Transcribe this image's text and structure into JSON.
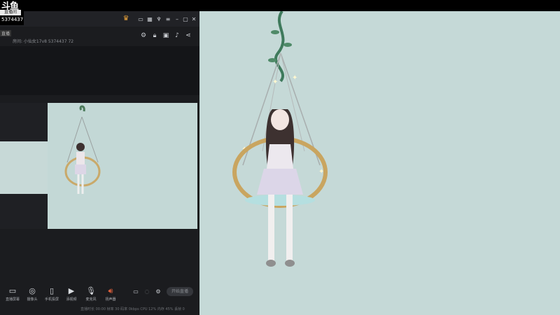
{
  "overlay": {
    "brand": "斗鱼",
    "tag": "直播间",
    "room_id": "5374437"
  },
  "app": {
    "live_tag": "直播",
    "room_meta": "房间: 小仙女17v8   5374437   72",
    "header_icons": [
      "settings-icon",
      "lock-icon",
      "gallery-icon",
      "bell-icon",
      "share-icon"
    ],
    "window_icons": [
      "skin-icon",
      "chat-icon",
      "grid-icon",
      "shirt-icon",
      "menu-icon",
      "minimize-icon",
      "maximize-icon",
      "close-icon"
    ]
  },
  "toolbar": {
    "items": [
      {
        "icon": "screen-capture-icon",
        "label": "直播屏幕"
      },
      {
        "icon": "camera-icon",
        "label": "摄像头"
      },
      {
        "icon": "phone-cast-icon",
        "label": "手机投屏"
      },
      {
        "icon": "media-icon",
        "label": "添视频"
      },
      {
        "icon": "mic-icon",
        "label": "麦克风"
      },
      {
        "icon": "speaker-icon",
        "label": "扬声器"
      }
    ],
    "go_live": "开始直播",
    "stats": "直播时长 00:00  帧率 30  码率 0kbps  CPU 12%  内存 45%  丢帧 0"
  },
  "colors": {
    "panel": "#1b1c1f",
    "stage": "#c5d9d7",
    "accent": "#e0603c"
  }
}
